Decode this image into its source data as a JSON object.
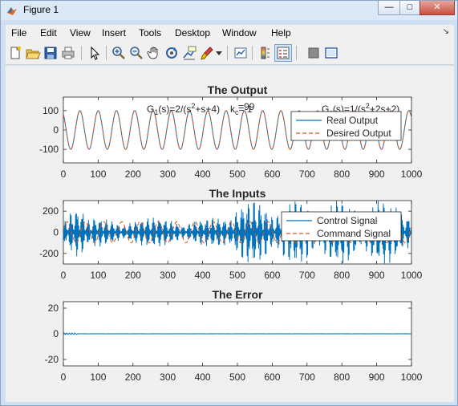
{
  "window": {
    "title": "Figure 1",
    "minimize": "—",
    "maximize": "□",
    "close": "✕"
  },
  "menu": [
    "File",
    "Edit",
    "View",
    "Insert",
    "Tools",
    "Desktop",
    "Window",
    "Help"
  ],
  "dock_arrow": "↘",
  "toolbar_icons": [
    "new-figure-icon",
    "open-file-icon",
    "save-icon",
    "print-icon",
    "edit-plot-arrow-icon",
    "zoom-in-icon",
    "zoom-out-icon",
    "pan-hand-icon",
    "rotate-3d-icon",
    "data-cursor-icon",
    "brush-icon",
    "brush-dropdown-icon",
    "link-plot-icon",
    "colorbar-icon",
    "legend-icon",
    "hide-plot-tools-icon",
    "show-plot-tools-icon"
  ],
  "chart_data": [
    {
      "type": "line",
      "title": "The Output",
      "xlim": [
        0,
        1000
      ],
      "ylim": [
        -170,
        170
      ],
      "xticks": [
        0,
        100,
        200,
        300,
        400,
        500,
        600,
        700,
        800,
        900,
        1000
      ],
      "yticks": [
        100,
        0,
        -100
      ],
      "xticklabels": [
        "0",
        "100",
        "200",
        "300",
        "400",
        "500",
        "600",
        "700",
        "800",
        "900",
        "1000"
      ],
      "yticklabels": [
        "100",
        "0",
        "-100"
      ],
      "annotations": [
        "G1(s)=2/(s2+s+4)",
        "kc= 1",
        "=99",
        "Gc(s)=1/(s2+2s+2)"
      ],
      "series": [
        {
          "name": "Real Output",
          "color": "#0072bd",
          "dash": "solid",
          "amplitude": 100,
          "period": 52.5,
          "phase": 0.6
        },
        {
          "name": "Desired Output",
          "color": "#d95319",
          "dash": "dashed",
          "amplitude": 100,
          "period": 52.5,
          "phase": 0.6
        }
      ],
      "legend_placement": "top-right"
    },
    {
      "type": "line",
      "title": "The Inputs",
      "xlim": [
        0,
        1000
      ],
      "ylim": [
        -300,
        300
      ],
      "xticks": [
        0,
        100,
        200,
        300,
        400,
        500,
        600,
        700,
        800,
        900,
        1000
      ],
      "yticks": [
        200,
        0,
        -200
      ],
      "xticklabels": [
        "0",
        "100",
        "200",
        "300",
        "400",
        "500",
        "600",
        "700",
        "800",
        "900",
        "1000"
      ],
      "yticklabels": [
        "200",
        "0",
        "-200"
      ],
      "series": [
        {
          "name": "Control Signal",
          "color": "#0072bd",
          "dash": "solid"
        },
        {
          "name": "Command Signal",
          "color": "#d95319",
          "dash": "dashed"
        }
      ],
      "legend_placement": "top-right"
    },
    {
      "type": "line",
      "title": "The Error",
      "xlim": [
        0,
        1000
      ],
      "ylim": [
        -25,
        25
      ],
      "xticks": [
        0,
        100,
        200,
        300,
        400,
        500,
        600,
        700,
        800,
        900,
        1000
      ],
      "yticks": [
        20,
        0,
        -20
      ],
      "xticklabels": [
        "0",
        "100",
        "200",
        "300",
        "400",
        "500",
        "600",
        "700",
        "800",
        "900",
        "1000"
      ],
      "yticklabels": [
        "20",
        "0",
        "-20"
      ],
      "series": [
        {
          "color": "#0072bd",
          "dash": "solid",
          "value": 0
        }
      ]
    }
  ]
}
